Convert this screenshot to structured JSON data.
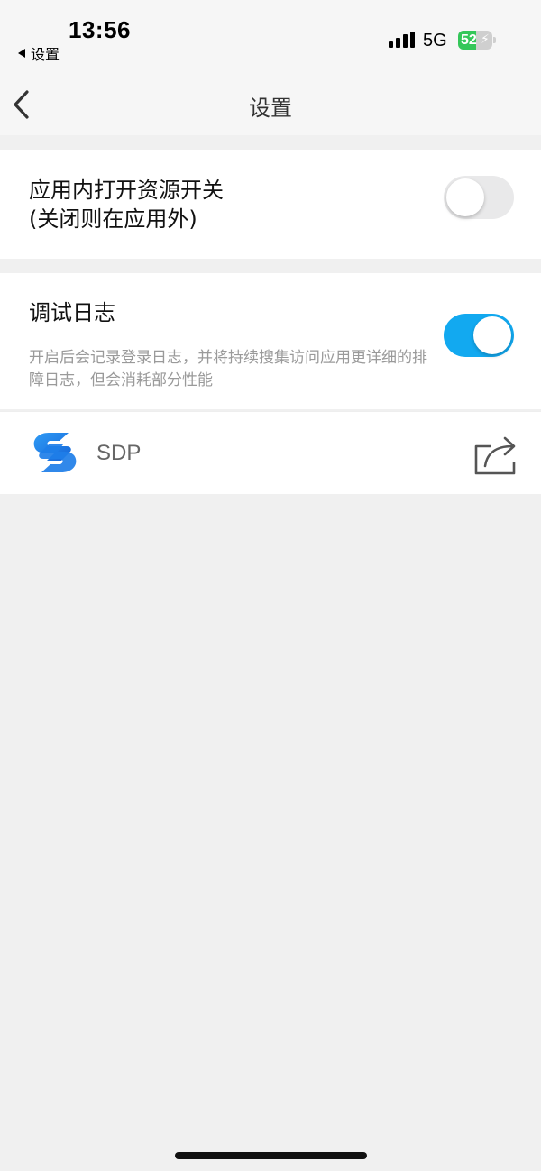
{
  "status_bar": {
    "time": "13:56",
    "back_app_label": "设置",
    "network": "5G",
    "battery_percent": "52",
    "battery_charging": true,
    "battery_color": "#34c759"
  },
  "nav": {
    "title": "设置",
    "back_icon": "chevron-left-icon"
  },
  "settings": {
    "in_app_open": {
      "label_line1": "应用内打开资源开关",
      "label_line2": "(关闭则在应用外)",
      "enabled": false
    },
    "debug_log": {
      "title": "调试日志",
      "description": "开启后会记录登录日志，并将持续搜集访问应用更详细的排障日志，但会消耗部分性能",
      "enabled": true,
      "toggle_on_color": "#12a9f0"
    },
    "app_entry": {
      "name": "SDP",
      "logo_icon": "sdp-logo-icon",
      "action_icon": "share-icon"
    }
  }
}
